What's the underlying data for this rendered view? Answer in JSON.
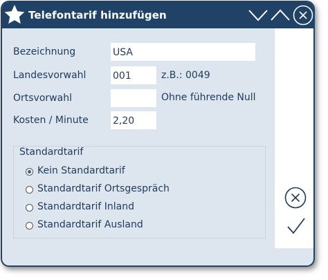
{
  "window": {
    "title": "Telefontarif hinzufügen",
    "icons": {
      "app": "star-icon",
      "minimize": "chevron-down-icon",
      "maximize": "chevron-up-icon",
      "close": "close-circle-icon"
    }
  },
  "form": {
    "bezeichnung_label": "Bezeichnung",
    "bezeichnung_value": "USA",
    "landesvorwahl_label": "Landesvorwahl",
    "landesvorwahl_value": "001",
    "landesvorwahl_hint": "z.B.: 0049",
    "ortsvorwahl_label": "Ortsvorwahl",
    "ortsvorwahl_value": "",
    "ortsvorwahl_hint": "Ohne führende Null",
    "kosten_label": "Kosten / Minute",
    "kosten_value": "2,20"
  },
  "standardtarif": {
    "legend": "Standardtarif",
    "selected": 0,
    "options": [
      {
        "label": "Kein Standardtarif"
      },
      {
        "label": "Standardtarif Ortsgespräch"
      },
      {
        "label": "Standardtarif Inland"
      },
      {
        "label": "Standardtarif Ausland"
      }
    ]
  },
  "actions": {
    "cancel_icon": "cancel-circle-icon",
    "confirm_icon": "checkmark-icon"
  },
  "colors": {
    "titlebar": "#1f4266",
    "background": "#dde6ef",
    "text": "#1e3a5c"
  }
}
